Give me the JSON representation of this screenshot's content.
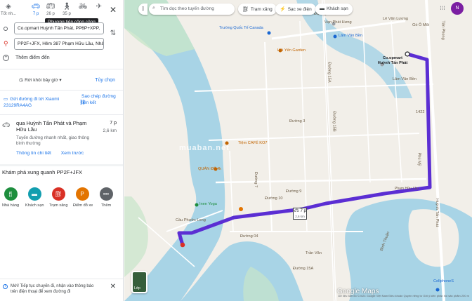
{
  "modes": [
    {
      "label": "Tốt nh...",
      "icon": "diamond-directions-icon"
    },
    {
      "label": "7 p",
      "icon": "car-icon",
      "active": true
    },
    {
      "label": "26 p",
      "icon": "bus-icon"
    },
    {
      "label": "35 p",
      "icon": "walk-icon"
    },
    {
      "label": "",
      "icon": "bike-icon"
    },
    {
      "label": "",
      "icon": "flight-icon"
    }
  ],
  "tooltip": "Phương tiện công cộng",
  "origin": "Co.opmart Huỳnh Tấn Phát, PP6P+XPP,",
  "destination": "PP2F+JFX, Hẻm 387 Phạm Hữu Lầu, Nhà",
  "add_destination": "Thêm điểm đến",
  "leave": "Rời khỏi bây giờ",
  "options": "Tùy chọn",
  "send_to": "Gửi đường đi tới Xiaomi 23129RA4AG",
  "copy_link": "Sao chép đường liên kết",
  "route": {
    "title": "qua Huỳnh Tấn Phát và Phạm Hữu Lầu",
    "time": "7 p",
    "distance": "2,6 km",
    "description": "Tuyến đường nhanh nhất, giao thông bình thường",
    "details": "Thông tin chi tiết",
    "preview": "Xem trước"
  },
  "explore_title": "Khám phá xung quanh PP2F+JFX",
  "categories": [
    {
      "label": "Nhà hàng",
      "icon": "restaurant-icon",
      "color": "#1e8e3e"
    },
    {
      "label": "Khách sạn",
      "icon": "hotel-icon",
      "color": "#129eaf"
    },
    {
      "label": "Trạm xăng",
      "icon": "gas-station-icon",
      "color": "#d93025"
    },
    {
      "label": "Điểm đỗ xe",
      "icon": "parking-icon",
      "color": "#e37400"
    },
    {
      "label": "Thêm",
      "icon": "more-icon",
      "color": "#5f6368"
    }
  ],
  "notice": "Mới! Tiếp tục chuyến đi, nhận vào thông báo trên điện thoại để xem đường đi",
  "map": {
    "search_placeholder": "Tìm dọc theo tuyến đường",
    "chips": [
      "Trạm xăng",
      "Sạc xe điện",
      "Khách sạn"
    ],
    "avatar_letter": "N",
    "layer_label": "Lớp",
    "route_time": "7 p",
    "route_distance": "2,6 km",
    "logo": "Google Maps",
    "copyright": "Dữ liệu bản đồ ©2024 Google   Việt Nam   Điều khoản   Quyền riêng tư   Gửi ý kiến phản hồi sản phẩm   200 m",
    "watermark": "muaban.net",
    "labels": [
      {
        "text": "Trường Quốc Tế Canada",
        "cls": "blue"
      },
      {
        "text": "Vạn Phát Hưng",
        "cls": ""
      },
      {
        "text": "Lâm Văn Bền",
        "cls": "blue"
      },
      {
        "text": "Hải Yến Garden",
        "cls": "orange"
      },
      {
        "text": "Co.opmart Huỳnh Tấn Phát",
        "cls": "dark"
      },
      {
        "text": "Tiệm CAFÉ KO7",
        "cls": "orange"
      },
      {
        "text": "QUÁN ĐỂ 4k",
        "cls": "orange"
      },
      {
        "text": "Inen Yoga",
        "cls": "green"
      },
      {
        "text": "Cầu Phước Long",
        "cls": ""
      },
      {
        "text": "Đường 15B",
        "cls": ""
      },
      {
        "text": "Đường 15A",
        "cls": ""
      },
      {
        "text": "Đường 04",
        "cls": ""
      },
      {
        "text": "Huỳnh Tấn Phát",
        "cls": ""
      },
      {
        "text": "Phạm Hữu Lầu",
        "cls": ""
      },
      {
        "text": "CellphoneS",
        "cls": "blue"
      },
      {
        "text": "Bình Thuận",
        "cls": ""
      },
      {
        "text": "Phú Mỹ",
        "cls": ""
      },
      {
        "text": "Tân Phong",
        "cls": ""
      },
      {
        "text": "Đường 9",
        "cls": ""
      },
      {
        "text": "Đường số 2",
        "cls": ""
      },
      {
        "text": "Lê Văn Lương",
        "cls": ""
      },
      {
        "text": "Gò Ô Môi",
        "cls": ""
      },
      {
        "text": "Lâm Văn Bền",
        "cls": ""
      },
      {
        "text": "Đường 3",
        "cls": ""
      },
      {
        "text": "1422",
        "cls": ""
      },
      {
        "text": "Đường 7",
        "cls": ""
      },
      {
        "text": "Đường 10",
        "cls": ""
      },
      {
        "text": "Trần Văn",
        "cls": ""
      },
      {
        "text": "Đường 15A",
        "cls": ""
      }
    ]
  }
}
